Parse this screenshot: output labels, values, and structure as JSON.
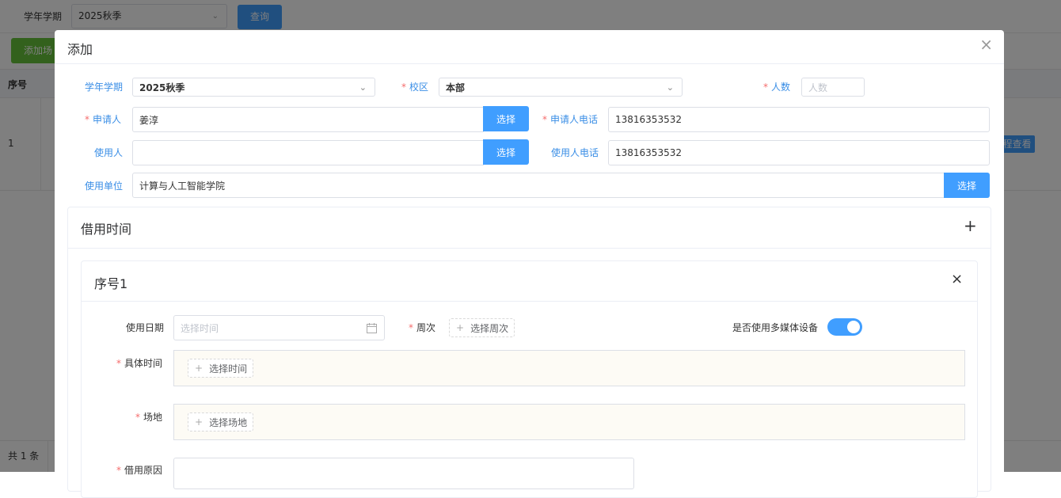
{
  "background": {
    "filter_label": "学年学期",
    "filter_value": "2025秋季",
    "query_button": "查询",
    "add_button": "添加场",
    "table_header_no": "序号",
    "row_no": "1",
    "view_button": "程查看",
    "footer_total": "共 1 条"
  },
  "dialog": {
    "title": "添加",
    "close_icon": "×",
    "term_label": "学年学期",
    "term_value": "2025秋季",
    "campus_label": "校区",
    "campus_value": "本部",
    "people_label": "人数",
    "people_placeholder": "人数",
    "applicant_label": "申请人",
    "applicant_value": "姜淳",
    "applicant_select": "选择",
    "applicant_phone_label": "申请人电话",
    "applicant_phone_value": "13816353532",
    "user_label": "使用人",
    "user_value": "",
    "user_select": "选择",
    "user_phone_label": "使用人电话",
    "user_phone_value": "13816353532",
    "unit_label": "使用单位",
    "unit_value": "计算与人工智能学院",
    "unit_select": "选择"
  },
  "borrow_card": {
    "title": "借用时间",
    "add_icon": "+",
    "item": {
      "title": "序号1",
      "close_icon": "×",
      "date_label": "使用日期",
      "date_placeholder": "选择时间",
      "week_label": "周次",
      "week_button": "选择周次",
      "multimedia_label": "是否使用多媒体设备",
      "multimedia_on": true,
      "time_label": "具体时间",
      "time_button": "选择时间",
      "venue_label": "场地",
      "venue_button": "选择场地",
      "reason_label": "借用原因"
    }
  },
  "colors": {
    "primary": "#409eff",
    "required": "#f56c6c",
    "label_blue": "#3a8ee6",
    "green": "#67c23a"
  }
}
